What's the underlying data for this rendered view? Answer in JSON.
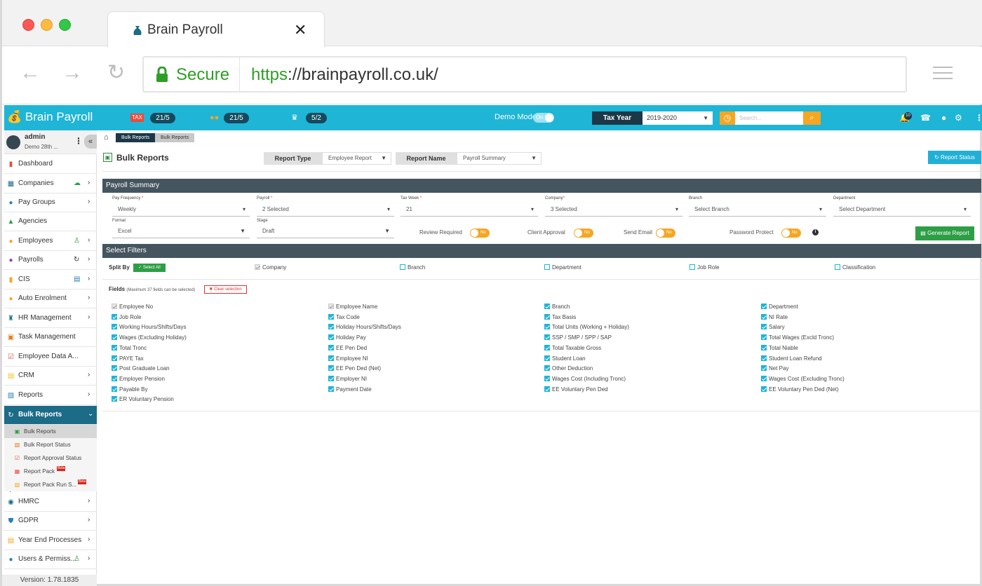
{
  "browser": {
    "tab_title": "Brain Payroll",
    "secure_label": "Secure",
    "url_scheme": "https",
    "url_rest": "://brainpayroll.co.uk/"
  },
  "header": {
    "brand": "Brain Payroll",
    "counters": [
      {
        "icon": "tax-icon",
        "value": "21/5"
      },
      {
        "icon": "coins-icon",
        "value": "21/5"
      },
      {
        "icon": "crown-icon",
        "value": "5/2"
      }
    ],
    "demo_mode_label": "Demo Mode",
    "demo_mode_state": "On",
    "tax_year_label": "Tax Year",
    "tax_year_value": "2019-2020",
    "search_placeholder": "Search...",
    "notification_count": "10"
  },
  "sidebar": {
    "user_name": "admin",
    "user_sub": "Demo 28th ...",
    "items": [
      {
        "label": "Dashboard",
        "icon": "chart-icon"
      },
      {
        "label": "Companies",
        "icon": "building-icon"
      },
      {
        "label": "Pay Groups",
        "icon": "money-bag-icon"
      },
      {
        "label": "Agencies",
        "icon": "agency-icon"
      },
      {
        "label": "Employees",
        "icon": "people-icon"
      },
      {
        "label": "Payrolls",
        "icon": "payroll-icon"
      },
      {
        "label": "CIS",
        "icon": "cis-icon"
      },
      {
        "label": "Auto Enrolment",
        "icon": "coins-icon"
      },
      {
        "label": "HR Management",
        "icon": "hr-icon"
      },
      {
        "label": "Task Management",
        "icon": "task-icon"
      },
      {
        "label": "Employee Data A...",
        "icon": "data-icon"
      },
      {
        "label": "CRM",
        "icon": "crm-icon"
      },
      {
        "label": "Reports",
        "icon": "reports-icon"
      },
      {
        "label": "Bulk Reports",
        "icon": "refresh-icon"
      }
    ],
    "sub_items": [
      {
        "label": "Bulk Reports"
      },
      {
        "label": "Bulk Report Status"
      },
      {
        "label": "Report Approval Status"
      },
      {
        "label": "Report Pack",
        "badge": "Beta"
      },
      {
        "label": "Report Pack Run S...",
        "badge": "Beta"
      }
    ],
    "bottom_items": [
      {
        "label": "HMRC",
        "icon": "hmrc-icon"
      },
      {
        "label": "GDPR",
        "icon": "shield-icon"
      },
      {
        "label": "Year End Processes",
        "icon": "calendar-icon"
      },
      {
        "label": "Users & Permiss...",
        "icon": "users-icon"
      }
    ],
    "version": "Version: 1.78.1835"
  },
  "main": {
    "breadcrumb": [
      "Bulk Reports",
      "Bulk Reports"
    ],
    "title": "Bulk Reports",
    "report_type_label": "Report Type",
    "report_type_value": "Employee Report",
    "report_name_label": "Report Name",
    "report_name_value": "Payroll Summary",
    "report_status_button": "Report Status",
    "section_title": "Payroll Summary",
    "form": {
      "pay_frequency_label": "Pay Frequency",
      "pay_frequency_value": "Weekly",
      "payroll_label": "Payroll",
      "payroll_value": "2 Selected",
      "tax_week_label": "Tax Week",
      "tax_week_value": "21",
      "company_label": "Company",
      "company_value": "3 Selected",
      "branch_label": "Branch",
      "branch_value": "Select Branch",
      "department_label": "Department",
      "department_value": "Select Department",
      "format_label": "Format",
      "format_value": "Excel",
      "stage_label": "Stage",
      "stage_value": "Draft",
      "review_required_label": "Review Required",
      "client_approval_label": "Client Approval",
      "send_email_label": "Send Email",
      "password_protect_label": "Password Protect",
      "toggle_no": "No",
      "generate_button": "Generate Report"
    },
    "filters": {
      "title": "Select Filters",
      "split_by_label": "Split By",
      "select_all": "Select All",
      "split_options": [
        {
          "label": "Company",
          "state": "disabled"
        },
        {
          "label": "Branch",
          "state": "off"
        },
        {
          "label": "Department",
          "state": "off"
        },
        {
          "label": "Job Role",
          "state": "off"
        },
        {
          "label": "Classification",
          "state": "off"
        }
      ],
      "fields_label": "Fields",
      "fields_note": "(Maximum 37 fields can be selected)",
      "clear_selection": "Clear selection",
      "fields": [
        {
          "label": "Employee No",
          "state": "disabled"
        },
        {
          "label": "Employee Name",
          "state": "disabled"
        },
        {
          "label": "Branch",
          "state": "on"
        },
        {
          "label": "Department",
          "state": "on"
        },
        {
          "label": "Job Role",
          "state": "on"
        },
        {
          "label": "Tax Code",
          "state": "on"
        },
        {
          "label": "Tax Basis",
          "state": "on"
        },
        {
          "label": "NI Rate",
          "state": "on"
        },
        {
          "label": "Working Hours/Shifts/Days",
          "state": "on"
        },
        {
          "label": "Holiday Hours/Shifts/Days",
          "state": "on"
        },
        {
          "label": "Total Units (Working + Holiday)",
          "state": "on"
        },
        {
          "label": "Salary",
          "state": "on"
        },
        {
          "label": "Wages (Excluding Holiday)",
          "state": "on"
        },
        {
          "label": "Holiday Pay",
          "state": "on"
        },
        {
          "label": "SSP / SMP / SPP / SAP",
          "state": "on"
        },
        {
          "label": "Total Wages (Excld Tronc)",
          "state": "on"
        },
        {
          "label": "Total Tronc",
          "state": "on"
        },
        {
          "label": "EE Pen Ded",
          "state": "on"
        },
        {
          "label": "Total Taxable Gross",
          "state": "on"
        },
        {
          "label": "Total Niable",
          "state": "on"
        },
        {
          "label": "PAYE Tax",
          "state": "on"
        },
        {
          "label": "Employee NI",
          "state": "on"
        },
        {
          "label": "Student Loan",
          "state": "on"
        },
        {
          "label": "Student Loan Refund",
          "state": "on"
        },
        {
          "label": "Post Graduate Loan",
          "state": "on"
        },
        {
          "label": "EE Pen Ded (Net)",
          "state": "on"
        },
        {
          "label": "Other Deduction",
          "state": "on"
        },
        {
          "label": "Net Pay",
          "state": "on"
        },
        {
          "label": "Employer Pension",
          "state": "on"
        },
        {
          "label": "Employer NI",
          "state": "on"
        },
        {
          "label": "Wages Cost (Including Tronc)",
          "state": "on"
        },
        {
          "label": "Wages Cost (Excluding Tronc)",
          "state": "on"
        },
        {
          "label": "Payable By",
          "state": "on"
        },
        {
          "label": "Payment Date",
          "state": "on"
        },
        {
          "label": "EE Voluntary Pen Ded",
          "state": "on"
        },
        {
          "label": "EE Voluntary Pen Ded (Net)",
          "state": "on"
        },
        {
          "label": "ER Voluntary Pension",
          "state": "on"
        }
      ]
    }
  }
}
